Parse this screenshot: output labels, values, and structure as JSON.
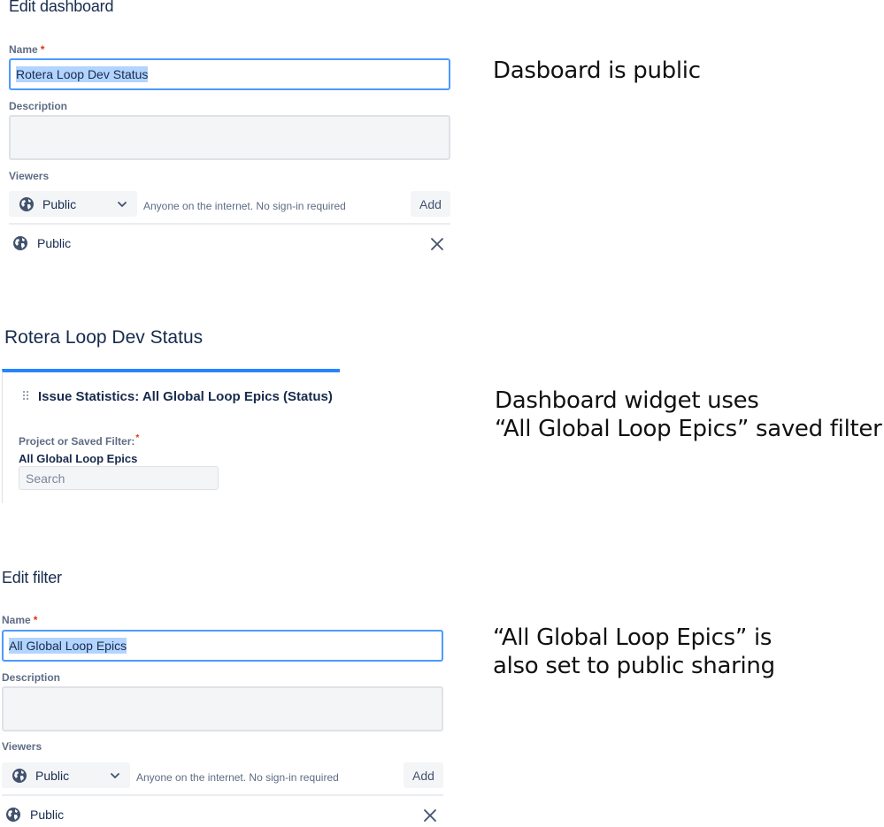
{
  "dashboard_form": {
    "title": "Edit dashboard",
    "name_label": "Name",
    "required_mark": "*",
    "name_value": "Rotera Loop Dev Status",
    "description_label": "Description",
    "viewers_label": "Viewers",
    "viewer_select": {
      "value": "Public",
      "icon": "globe-icon"
    },
    "viewer_hint": "Anyone on the internet. No sign-in required",
    "add_label": "Add",
    "viewer_entry": {
      "label": "Public",
      "icon": "globe-icon",
      "remove_icon": "close-icon"
    }
  },
  "annotations": {
    "first": "Dasboard is public",
    "second_line1": "Dashboard widget uses",
    "second_line2": "“All Global Loop Epics” saved filter",
    "third_line1": "“All Global Loop Epics” is",
    "third_line2": "also set to public sharing"
  },
  "widget": {
    "dashboard_title": "Rotera Loop Dev Status",
    "heading": "Issue Statistics: All Global Loop Epics (Status)",
    "filter_label": "Project or Saved Filter:",
    "required_mark": "*",
    "filter_value": "All Global Loop Epics",
    "search_placeholder": "Search",
    "accent_color": "#2684ff"
  },
  "filter_form": {
    "title": "Edit filter",
    "name_label": "Name",
    "required_mark": "*",
    "name_value": "All Global Loop Epics",
    "description_label": "Description",
    "viewers_label": "Viewers",
    "viewer_select": {
      "value": "Public",
      "icon": "globe-icon"
    },
    "viewer_hint": "Anyone on the internet. No sign-in required",
    "add_label": "Add",
    "viewer_entry": {
      "label": "Public",
      "icon": "globe-icon",
      "remove_icon": "close-icon"
    }
  },
  "colors": {
    "focus_border": "#4c9aff",
    "selection": "#b3d4ff",
    "required": "#de350b",
    "text": "#172b4d"
  }
}
